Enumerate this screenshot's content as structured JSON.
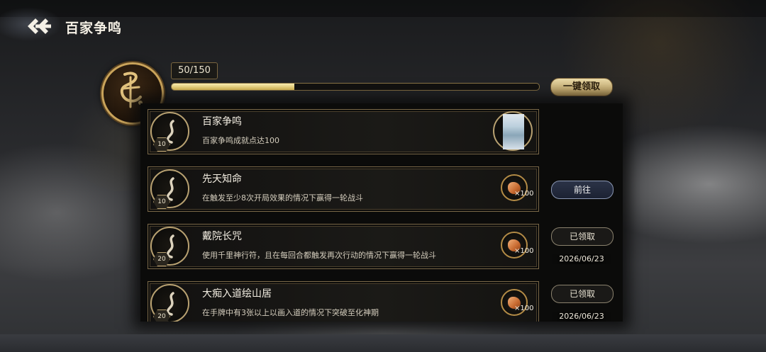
{
  "header": {
    "title": "百家争鸣",
    "back_icon": "double-chevron-left-icon"
  },
  "progress": {
    "label": "50/150",
    "current": 50,
    "max": 150
  },
  "claim_all_label": "一键领取",
  "colors": {
    "accent_gold": "#c9a35a",
    "progress_fill": "#e6c45a"
  },
  "tasks": [
    {
      "title": "百家争鸣",
      "desc": "百家争鸣成就点达100",
      "level": "10",
      "reward_type": "painting",
      "reward_count": ""
    },
    {
      "title": "先天知命",
      "desc": "在触发至少8次开局效果的情况下赢得一轮战斗",
      "level": "10",
      "reward_type": "stone",
      "reward_count": "×100",
      "action": "前往",
      "date": ""
    },
    {
      "title": "戴院长咒",
      "desc": "使用千里神行符，且在每回合都触发再次行动的情况下赢得一轮战斗",
      "level": "20",
      "reward_type": "stone",
      "reward_count": "×100",
      "action": "已领取",
      "date": "2026/06/23"
    },
    {
      "title": "大痴入道绘山居",
      "desc": "在手牌中有3张以上以画入道的情况下突破至化神期",
      "level": "20",
      "reward_type": "stone",
      "reward_count": "×100",
      "action": "已领取",
      "date": "2026/06/23"
    }
  ]
}
